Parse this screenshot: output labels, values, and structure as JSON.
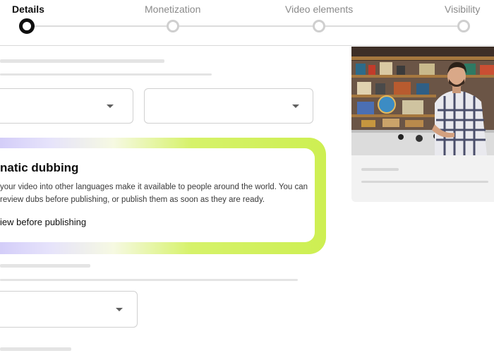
{
  "stepper": {
    "steps": [
      {
        "label": "Details",
        "active": true
      },
      {
        "label": "Monetization",
        "active": false
      },
      {
        "label": "Video elements",
        "active": false
      },
      {
        "label": "Visibility",
        "active": false
      }
    ]
  },
  "dubbing": {
    "title": "natic dubbing",
    "description_line1": "your video into other languages make it available to people around the world. You can",
    "description_line2": "review dubs before publishing, or publish them as soon as they are ready.",
    "option_label": "iew before publishing"
  },
  "colors": {
    "active_step": "#0f0f0f",
    "inactive_step": "#cfcfcf",
    "card_gradient_start": "#c9c1f7",
    "card_gradient_end": "#cdef52"
  },
  "icons": {
    "dropdown": "chevron-down-icon"
  }
}
